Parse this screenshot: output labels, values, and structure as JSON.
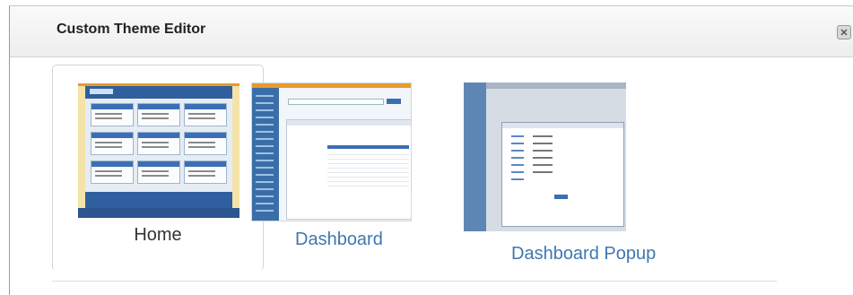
{
  "dialog": {
    "title": "Custom Theme Editor"
  },
  "themes": [
    {
      "label": "Home",
      "selected": true
    },
    {
      "label": "Dashboard",
      "selected": false
    },
    {
      "label": "Dashboard Popup",
      "selected": false
    }
  ],
  "icons": {
    "close": "close-icon"
  },
  "colors": {
    "link": "#3d78b0",
    "header_bar": "#eeeeee",
    "thumbnail_accent": "#e89a2b",
    "thumbnail_brand": "#2f5f9e"
  }
}
